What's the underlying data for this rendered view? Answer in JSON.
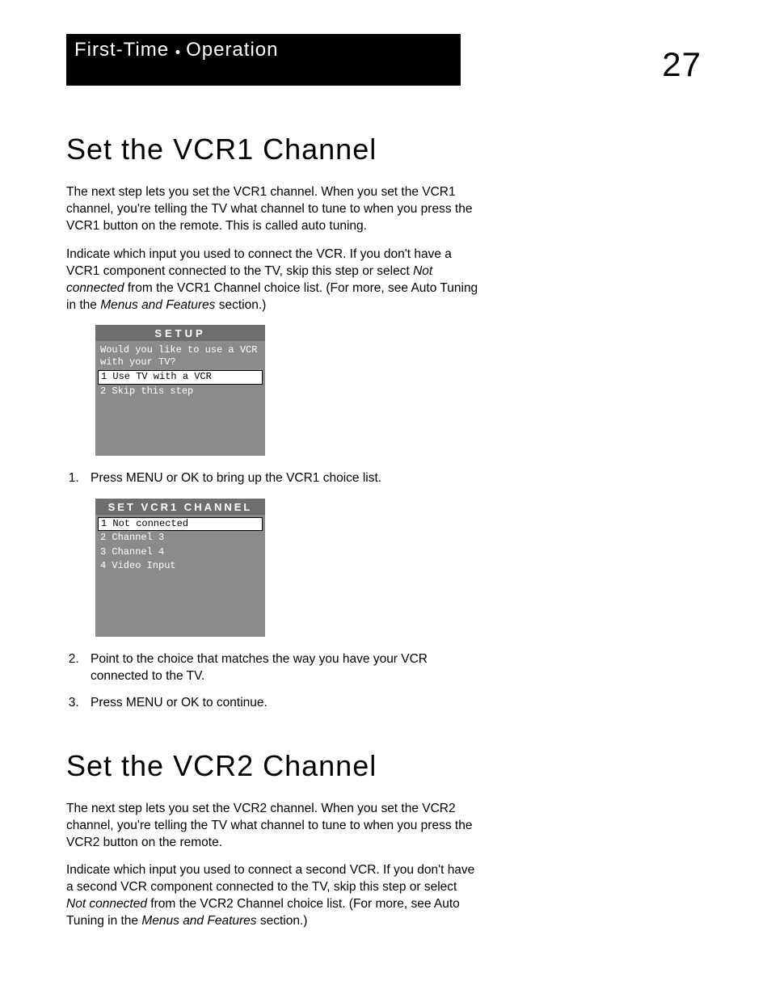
{
  "banner": {
    "line1_prefix": "First-Time ",
    "line1_dot": "• ",
    "line1_rest": "Operation"
  },
  "page_number": "27",
  "section1": {
    "title": "Set the VCR1 Channel",
    "para1": "The next step lets you set the VCR1 channel. When you set the VCR1 channel, you're telling the TV what channel to tune to when you press the VCR1 button on the remote. This is called auto tuning.",
    "para2_a": "Indicate which input you used to connect the VCR.  If you don't have a VCR1 component connected to the TV, skip this step or select ",
    "para2_italic1": "Not connected",
    "para2_b": " from the VCR1 Channel choice list. (For more, see Auto Tuning in the ",
    "para2_italic2": "Menus and Features",
    "para2_c": " section.)"
  },
  "menu1": {
    "title": "SETUP",
    "prompt": "Would you like to use a VCR with your TV?",
    "opt1": "1 Use TV with a VCR",
    "opt2": "2 Skip this step"
  },
  "steps1": {
    "s1": "Press MENU or OK to bring up the VCR1 choice list."
  },
  "menu2": {
    "title": "SET VCR1 CHANNEL",
    "opt1": "1 Not connected",
    "opt2": "2 Channel 3",
    "opt3": "3 Channel 4",
    "opt4": "4 Video Input"
  },
  "steps2": {
    "s2": "Point to the choice that matches the way you have your VCR connected to the TV.",
    "s3": "Press MENU or OK to continue."
  },
  "section2": {
    "title": "Set the VCR2 Channel",
    "para1": "The next step lets you set the VCR2 channel. When you set the VCR2 channel, you're telling the TV what channel to tune to when you press the VCR2 button on the remote.",
    "para2_a": "Indicate which input you used to connect a second VCR.  If you don't have a second VCR component connected to the TV, skip this step or select ",
    "para2_italic1": "Not connected",
    "para2_b": " from the VCR2 Channel choice list. (For more, see Auto Tuning in the ",
    "para2_italic2": "Menus and Features",
    "para2_c": " section.)"
  }
}
